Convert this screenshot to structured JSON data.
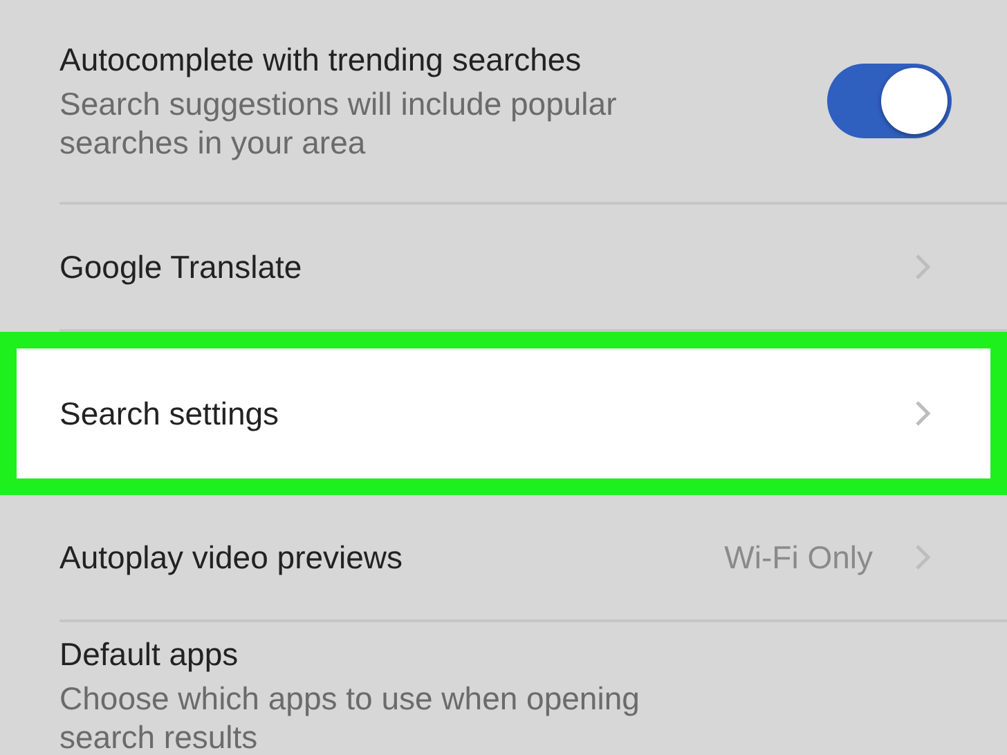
{
  "settings": [
    {
      "kind": "toggle",
      "title": "Autocomplete with trending searches",
      "subtitle": "Search suggestions will include popular searches in your area",
      "on": true,
      "highlighted": false
    },
    {
      "kind": "link",
      "title": "Google Translate",
      "highlighted": false
    },
    {
      "kind": "link",
      "title": "Search settings",
      "highlighted": true
    },
    {
      "kind": "link",
      "title": "Autoplay video previews",
      "value": "Wi-Fi Only",
      "highlighted": false
    },
    {
      "kind": "text",
      "title": "Default apps",
      "subtitle": "Choose which apps to use when opening search results",
      "highlighted": false
    }
  ]
}
